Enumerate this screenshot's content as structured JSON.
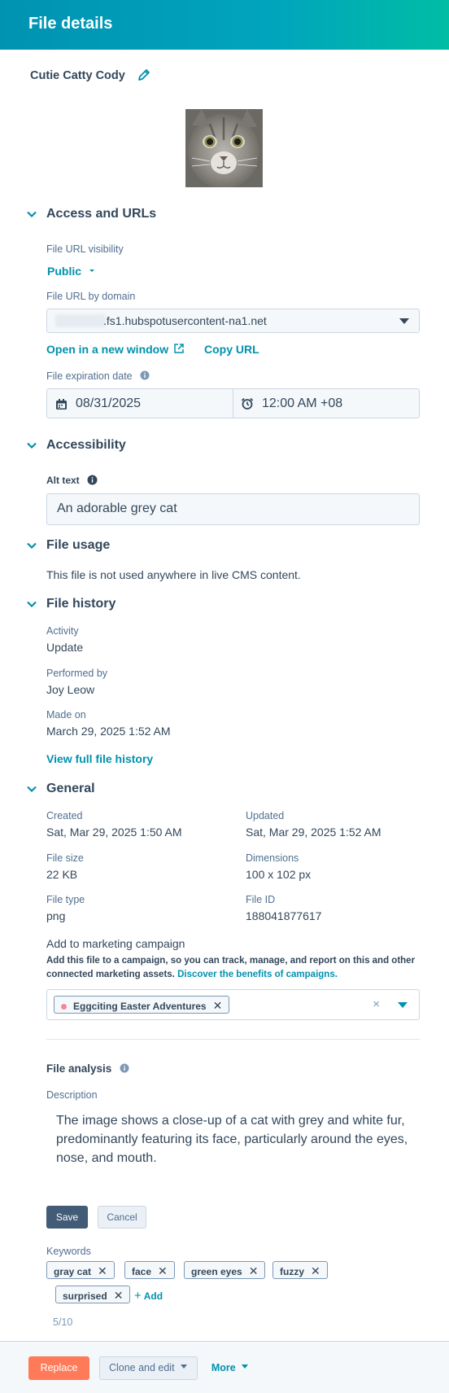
{
  "header": {
    "title": "File details"
  },
  "file": {
    "name": "Cutie Catty Cody"
  },
  "access": {
    "section_title": "Access and URLs",
    "visibility_label": "File URL visibility",
    "visibility_value": "Public",
    "domain_label": "File URL by domain",
    "domain_value": ".fs1.hubspotusercontent-na1.net",
    "open_link": "Open in a new window",
    "copy_link": "Copy URL",
    "expiration_label": "File expiration date",
    "expiration_date": "08/31/2025",
    "expiration_time": "12:00 AM +08"
  },
  "accessibility": {
    "section_title": "Accessibility",
    "alt_label": "Alt text",
    "alt_value": "An adorable grey cat"
  },
  "usage": {
    "section_title": "File usage",
    "text": "This file is not used anywhere in live CMS content."
  },
  "history": {
    "section_title": "File history",
    "activity_label": "Activity",
    "activity_value": "Update",
    "performed_label": "Performed by",
    "performed_value": "Joy Leow",
    "made_label": "Made on",
    "made_value": "March 29, 2025 1:52 AM",
    "full_link": "View full file history"
  },
  "general": {
    "section_title": "General",
    "created_label": "Created",
    "created_value": "Sat, Mar 29, 2025 1:50 AM",
    "updated_label": "Updated",
    "updated_value": "Sat, Mar 29, 2025 1:52 AM",
    "size_label": "File size",
    "size_value": "22 KB",
    "dimensions_label": "Dimensions",
    "dimensions_value": "100 x 102 px",
    "type_label": "File type",
    "type_value": "png",
    "id_label": "File ID",
    "id_value": "188041877617",
    "campaign_title": "Add to marketing campaign",
    "campaign_help": "Add this file to a campaign, so you can track, manage, and report on this and other connected marketing assets.",
    "campaign_link": "Discover the benefits of campaigns.",
    "campaign_tag": "Eggciting Easter Adventures",
    "campaign_clear": "×"
  },
  "analysis": {
    "title": "File analysis",
    "description_label": "Description",
    "description": "The image shows a close-up of a cat with grey and white fur, predominantly featuring its face, particularly around the eyes, nose, and mouth.",
    "save": "Save",
    "cancel": "Cancel",
    "keywords_label": "Keywords",
    "keywords": [
      "gray cat",
      "face",
      "green eyes",
      "fuzzy",
      "surprised"
    ],
    "add_label": "Add",
    "count": "5/10"
  },
  "footer": {
    "replace": "Replace",
    "clone": "Clone and edit",
    "more": "More"
  },
  "colors": {
    "accent": "#0091ae",
    "primary_dark": "#425b76",
    "orange": "#ff7a59",
    "text": "#33475b"
  }
}
